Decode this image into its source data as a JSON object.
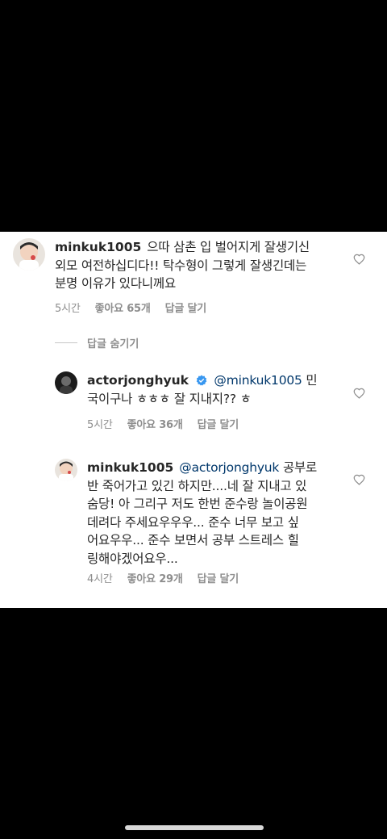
{
  "comments": [
    {
      "username": "minkuk1005",
      "text_line1": "으따 삼촌 입 벌어지게 잘생기신",
      "text_line2": "외모 여전하십디다!! 탁수형이 그렇게 잘생긴데는",
      "text_line3": "분명 이유가 있다니께요",
      "time": "5시간",
      "likes": "좋아요 65개",
      "reply": "답글 달기"
    },
    {
      "username": "actorjonghyuk",
      "verified": true,
      "mention": "@minkuk1005",
      "text_line1_rest": "민",
      "text_line2": "국이구나 ㅎㅎㅎ 잘 지내지?? ㅎ",
      "time": "5시간",
      "likes": "좋아요 36개",
      "reply": "답글 달기"
    },
    {
      "username": "minkuk1005",
      "mention": "@actorjonghyuk",
      "text_line1_rest": "공부로",
      "text_line2": "반 죽어가고 있긴 하지만....네 잘 지내고 있",
      "text_line3": "숨당! 아 그리구 저도 한번 준수랑 놀이공원",
      "text_line4": "데려다 주세요우우우... 준수 너무 보고 싶",
      "text_line5": "어요우우... 준수 보면서 공부 스트레스 힐",
      "text_line6": "링해야겠어요우...",
      "time": "4시간",
      "likes": "좋아요 29개",
      "reply": "답글 달기"
    }
  ],
  "hide_replies": "답글 숨기기",
  "icons": {
    "heart": "heart-outline-icon",
    "verified": "verified-badge-icon"
  },
  "colors": {
    "text": "#262626",
    "meta": "#8e8e8e",
    "mention": "#00376b",
    "verified": "#3897f0"
  }
}
